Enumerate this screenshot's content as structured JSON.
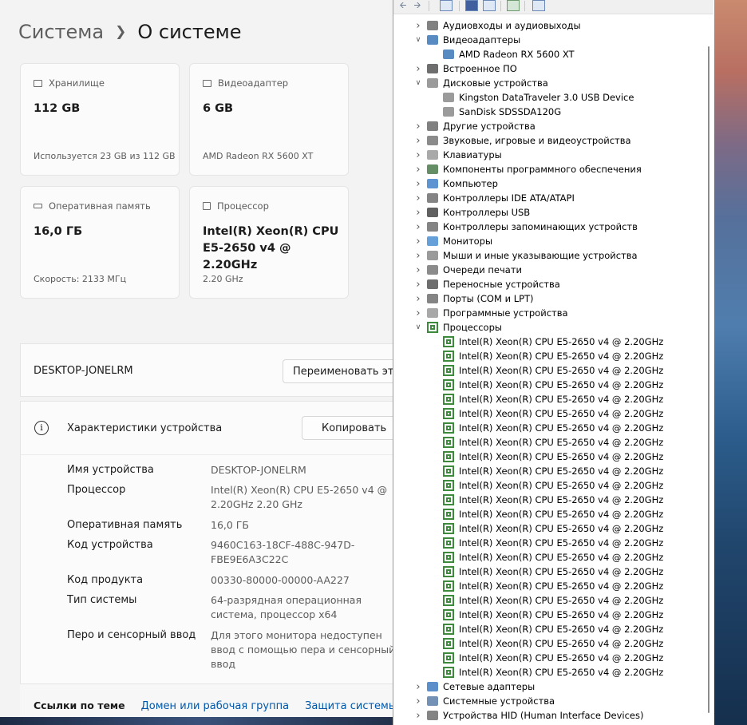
{
  "settings": {
    "breadcrumb": {
      "parent": "Система",
      "current": "О системе"
    },
    "cards": [
      {
        "icon": "storage-icon",
        "label": "Хранилище",
        "value": "112 GB",
        "sub": "Используется 23 GB из 112 GB"
      },
      {
        "icon": "gpu-icon",
        "label": "Видеоадаптер",
        "value": "6 GB",
        "sub": "AMD Radeon RX 5600 XT"
      },
      {
        "icon": "ram-icon",
        "label": "Оперативная память",
        "value": "16,0 ГБ",
        "sub": "Скорость: 2133 МГц"
      },
      {
        "icon": "cpu-icon",
        "label": "Процессор",
        "value": "Intel(R) Xeon(R) CPU E5-2650 v4 @ 2.20GHz",
        "sub": "2.20 GHz"
      }
    ],
    "device_name": "DESKTOP-JONELRM",
    "rename_button": "Переименовать этот ПК",
    "specs": {
      "title": "Характеристики устройства",
      "copy_button": "Копировать",
      "rows": [
        {
          "label": "Имя устройства",
          "value": "DESKTOP-JONELRM"
        },
        {
          "label": "Процессор",
          "value": "Intel(R) Xeon(R) CPU E5-2650 v4 @ 2.20GHz   2.20 GHz"
        },
        {
          "label": "Оперативная память",
          "value": "16,0 ГБ"
        },
        {
          "label": "Код устройства",
          "value": "9460C163-18CF-488C-947D-FBE9E6A3C22C"
        },
        {
          "label": "Код продукта",
          "value": "00330-80000-00000-AA227"
        },
        {
          "label": "Тип системы",
          "value": "64-разрядная операционная система, процессор x64"
        },
        {
          "label": "Перо и сенсорный ввод",
          "value": "Для этого монитора недоступен ввод с помощью пера и сенсорный ввод"
        }
      ]
    },
    "related": {
      "label": "Ссылки по теме",
      "links": [
        "Домен или рабочая группа",
        "Защита системы"
      ]
    }
  },
  "device_manager": {
    "tree": [
      {
        "label": "Аудиовходы и аудиовыходы",
        "level": 0,
        "expanded": false,
        "icon": "audio-icon"
      },
      {
        "label": "Видеоадаптеры",
        "level": 0,
        "expanded": true,
        "icon": "display-adapter-icon"
      },
      {
        "label": "AMD Radeon RX 5600 XT",
        "level": 1,
        "icon": "display-adapter-icon"
      },
      {
        "label": "Встроенное ПО",
        "level": 0,
        "expanded": false,
        "icon": "firmware-icon"
      },
      {
        "label": "Дисковые устройства",
        "level": 0,
        "expanded": true,
        "icon": "disk-icon"
      },
      {
        "label": "Kingston DataTraveler 3.0 USB Device",
        "level": 1,
        "icon": "disk-icon"
      },
      {
        "label": "SanDisk SDSSDA120G",
        "level": 1,
        "icon": "disk-icon"
      },
      {
        "label": "Другие устройства",
        "level": 0,
        "expanded": false,
        "icon": "other-devices-icon"
      },
      {
        "label": "Звуковые, игровые и видеоустройства",
        "level": 0,
        "expanded": false,
        "icon": "sound-icon"
      },
      {
        "label": "Клавиатуры",
        "level": 0,
        "expanded": false,
        "icon": "keyboard-icon"
      },
      {
        "label": "Компоненты программного обеспечения",
        "level": 0,
        "expanded": false,
        "icon": "software-component-icon"
      },
      {
        "label": "Компьютер",
        "level": 0,
        "expanded": false,
        "icon": "computer-icon"
      },
      {
        "label": "Контроллеры IDE ATA/ATAPI",
        "level": 0,
        "expanded": false,
        "icon": "ide-controller-icon"
      },
      {
        "label": "Контроллеры USB",
        "level": 0,
        "expanded": false,
        "icon": "usb-icon"
      },
      {
        "label": "Контроллеры запоминающих устройств",
        "level": 0,
        "expanded": false,
        "icon": "storage-controller-icon"
      },
      {
        "label": "Мониторы",
        "level": 0,
        "expanded": false,
        "icon": "monitor-icon"
      },
      {
        "label": "Мыши и иные указывающие устройства",
        "level": 0,
        "expanded": false,
        "icon": "mouse-icon"
      },
      {
        "label": "Очереди печати",
        "level": 0,
        "expanded": false,
        "icon": "printer-icon"
      },
      {
        "label": "Переносные устройства",
        "level": 0,
        "expanded": false,
        "icon": "portable-device-icon"
      },
      {
        "label": "Порты (COM и LPT)",
        "level": 0,
        "expanded": false,
        "icon": "port-icon"
      },
      {
        "label": "Программные устройства",
        "level": 0,
        "expanded": false,
        "icon": "software-device-icon"
      },
      {
        "label": "Процессоры",
        "level": 0,
        "expanded": true,
        "icon": "cpu-icon"
      },
      {
        "label": "Intel(R) Xeon(R) CPU E5-2650 v4 @ 2.20GHz",
        "level": 1,
        "icon": "cpu-icon"
      },
      {
        "label": "Intel(R) Xeon(R) CPU E5-2650 v4 @ 2.20GHz",
        "level": 1,
        "icon": "cpu-icon"
      },
      {
        "label": "Intel(R) Xeon(R) CPU E5-2650 v4 @ 2.20GHz",
        "level": 1,
        "icon": "cpu-icon"
      },
      {
        "label": "Intel(R) Xeon(R) CPU E5-2650 v4 @ 2.20GHz",
        "level": 1,
        "icon": "cpu-icon"
      },
      {
        "label": "Intel(R) Xeon(R) CPU E5-2650 v4 @ 2.20GHz",
        "level": 1,
        "icon": "cpu-icon"
      },
      {
        "label": "Intel(R) Xeon(R) CPU E5-2650 v4 @ 2.20GHz",
        "level": 1,
        "icon": "cpu-icon"
      },
      {
        "label": "Intel(R) Xeon(R) CPU E5-2650 v4 @ 2.20GHz",
        "level": 1,
        "icon": "cpu-icon"
      },
      {
        "label": "Intel(R) Xeon(R) CPU E5-2650 v4 @ 2.20GHz",
        "level": 1,
        "icon": "cpu-icon"
      },
      {
        "label": "Intel(R) Xeon(R) CPU E5-2650 v4 @ 2.20GHz",
        "level": 1,
        "icon": "cpu-icon"
      },
      {
        "label": "Intel(R) Xeon(R) CPU E5-2650 v4 @ 2.20GHz",
        "level": 1,
        "icon": "cpu-icon"
      },
      {
        "label": "Intel(R) Xeon(R) CPU E5-2650 v4 @ 2.20GHz",
        "level": 1,
        "icon": "cpu-icon"
      },
      {
        "label": "Intel(R) Xeon(R) CPU E5-2650 v4 @ 2.20GHz",
        "level": 1,
        "icon": "cpu-icon"
      },
      {
        "label": "Intel(R) Xeon(R) CPU E5-2650 v4 @ 2.20GHz",
        "level": 1,
        "icon": "cpu-icon"
      },
      {
        "label": "Intel(R) Xeon(R) CPU E5-2650 v4 @ 2.20GHz",
        "level": 1,
        "icon": "cpu-icon"
      },
      {
        "label": "Intel(R) Xeon(R) CPU E5-2650 v4 @ 2.20GHz",
        "level": 1,
        "icon": "cpu-icon"
      },
      {
        "label": "Intel(R) Xeon(R) CPU E5-2650 v4 @ 2.20GHz",
        "level": 1,
        "icon": "cpu-icon"
      },
      {
        "label": "Intel(R) Xeon(R) CPU E5-2650 v4 @ 2.20GHz",
        "level": 1,
        "icon": "cpu-icon"
      },
      {
        "label": "Intel(R) Xeon(R) CPU E5-2650 v4 @ 2.20GHz",
        "level": 1,
        "icon": "cpu-icon"
      },
      {
        "label": "Intel(R) Xeon(R) CPU E5-2650 v4 @ 2.20GHz",
        "level": 1,
        "icon": "cpu-icon"
      },
      {
        "label": "Intel(R) Xeon(R) CPU E5-2650 v4 @ 2.20GHz",
        "level": 1,
        "icon": "cpu-icon"
      },
      {
        "label": "Intel(R) Xeon(R) CPU E5-2650 v4 @ 2.20GHz",
        "level": 1,
        "icon": "cpu-icon"
      },
      {
        "label": "Intel(R) Xeon(R) CPU E5-2650 v4 @ 2.20GHz",
        "level": 1,
        "icon": "cpu-icon"
      },
      {
        "label": "Intel(R) Xeon(R) CPU E5-2650 v4 @ 2.20GHz",
        "level": 1,
        "icon": "cpu-icon"
      },
      {
        "label": "Intel(R) Xeon(R) CPU E5-2650 v4 @ 2.20GHz",
        "level": 1,
        "icon": "cpu-icon"
      },
      {
        "label": "Сетевые адаптеры",
        "level": 0,
        "expanded": false,
        "icon": "network-adapter-icon"
      },
      {
        "label": "Системные устройства",
        "level": 0,
        "expanded": false,
        "icon": "system-devices-icon"
      },
      {
        "label": "Устройства HID (Human Interface Devices)",
        "level": 0,
        "expanded": false,
        "icon": "hid-icon"
      }
    ]
  },
  "colors": {
    "accent": "#0056a8",
    "cpu_icon": "#3d8a3d",
    "window_bg": "#f3f3f3"
  }
}
